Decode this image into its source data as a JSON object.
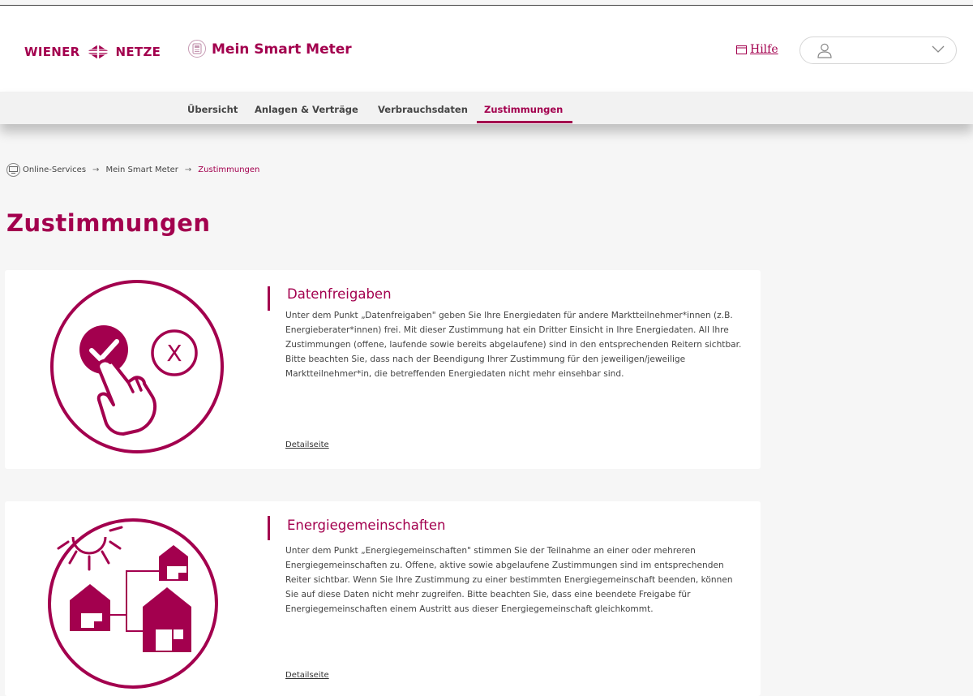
{
  "header": {
    "logo_left": "WIENER",
    "logo_right": "NETZE",
    "app_title": "Mein Smart Meter",
    "help_label": "Hilfe"
  },
  "nav": {
    "items": [
      "Übersicht",
      "Anlagen & Verträge",
      "Verbrauchsdaten",
      "Zustimmungen"
    ],
    "active": "Zustimmungen"
  },
  "breadcrumb": {
    "items": [
      "Online-Services",
      "Mein Smart Meter",
      "Zustimmungen"
    ],
    "separator": "→"
  },
  "page": {
    "title": "Zustimmungen"
  },
  "cards": [
    {
      "title": "Datenfreigaben",
      "body": "Unter dem Punkt „Datenfreigaben\" geben Sie Ihre Energiedaten für andere Marktteilnehmer*innen (z.B. Energieberater*innen) frei. Mit dieser Zustimmung hat ein Dritter Einsicht in Ihre Energiedaten. All Ihre Zustimmungen (offene, laufende sowie bereits abgelaufene) sind in den entsprechenden Reitern sichtbar. Bitte beachten Sie, dass nach der Beendigung Ihrer Zustimmung für den jeweiligen/jeweilige Marktteilnehmer*in, die betreffenden Energiedaten nicht mehr einsehbar sind.",
      "link": "Detailseite",
      "icon": "consent-check-hand-icon"
    },
    {
      "title": "Energiegemeinschaften",
      "body": "Unter dem Punkt „Energiegemeinschaften\" stimmen Sie der Teilnahme an einer oder mehreren Energiegemeinschaften zu. Offene, aktive sowie abgelaufene Zustimmungen sind im entsprechenden Reiter sichtbar. Wenn Sie Ihre Zustimmung zu einer bestimmten Energiegemeinschaft beenden, können Sie auf diese Daten nicht mehr zugreifen. Bitte beachten Sie, dass eine beendete Freigabe für Energiegemeinschaften einem Austritt aus dieser Energiegemeinschaft gleichkommt.",
      "link": "Detailseite",
      "icon": "energy-community-houses-icon"
    }
  ],
  "colors": {
    "brand": "#a3004e",
    "background": "#f6f6f6",
    "card": "#ffffff"
  }
}
